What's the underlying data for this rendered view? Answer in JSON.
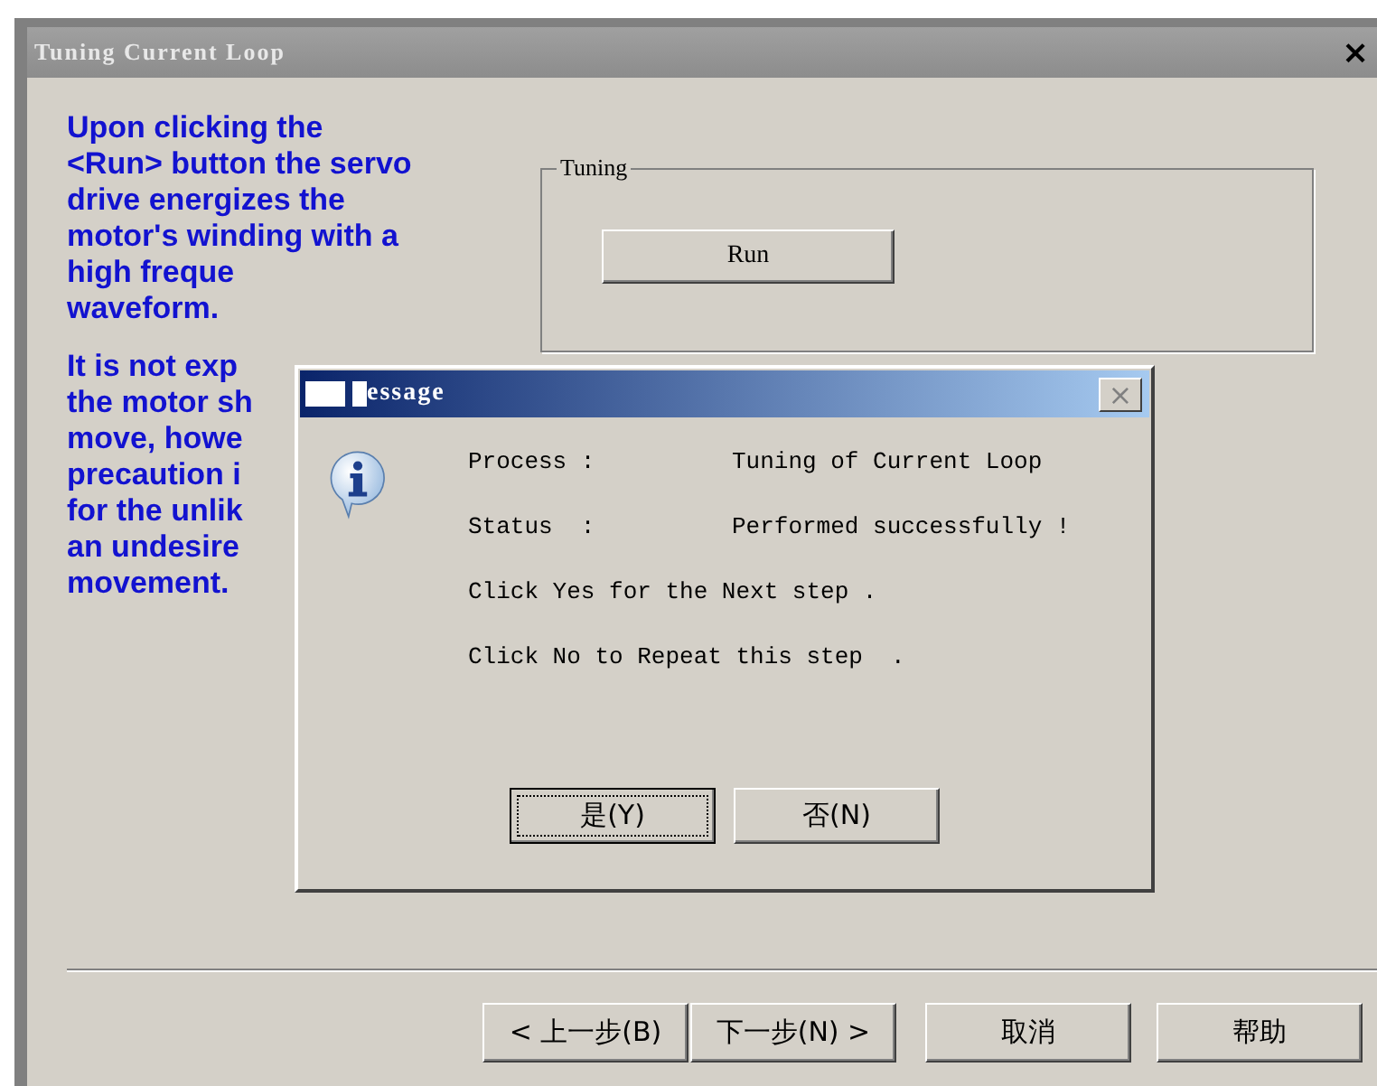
{
  "window": {
    "title": "Tuning Current Loop",
    "close": "×"
  },
  "instructions": [
    [
      "Upon clicking the",
      "<Run> button the servo",
      "drive energizes the",
      "motor's winding with a",
      "high freque",
      "waveform."
    ],
    [
      "It is not exp",
      "the motor sh",
      "move, howe",
      "precaution i",
      "for the unlik",
      "an undesire",
      "movement."
    ]
  ],
  "tuning": {
    "legend": "Tuning",
    "button": "Run"
  },
  "message": {
    "title": "essage",
    "close": "×",
    "rows": [
      {
        "label": "Process :",
        "value": "Tuning of Current Loop"
      },
      {
        "label": "Status  :",
        "value": "Performed successfully !"
      }
    ],
    "lines": [
      "Click Yes for the Next step .",
      "Click No to Repeat this step  ."
    ],
    "buttons": [
      {
        "label": "是(Y)",
        "focused": true
      },
      {
        "label": "否(N)",
        "focused": false
      }
    ]
  },
  "wizard_buttons": [
    "< 上一步(B)",
    "下一步(N) >",
    "取消",
    "帮助"
  ]
}
